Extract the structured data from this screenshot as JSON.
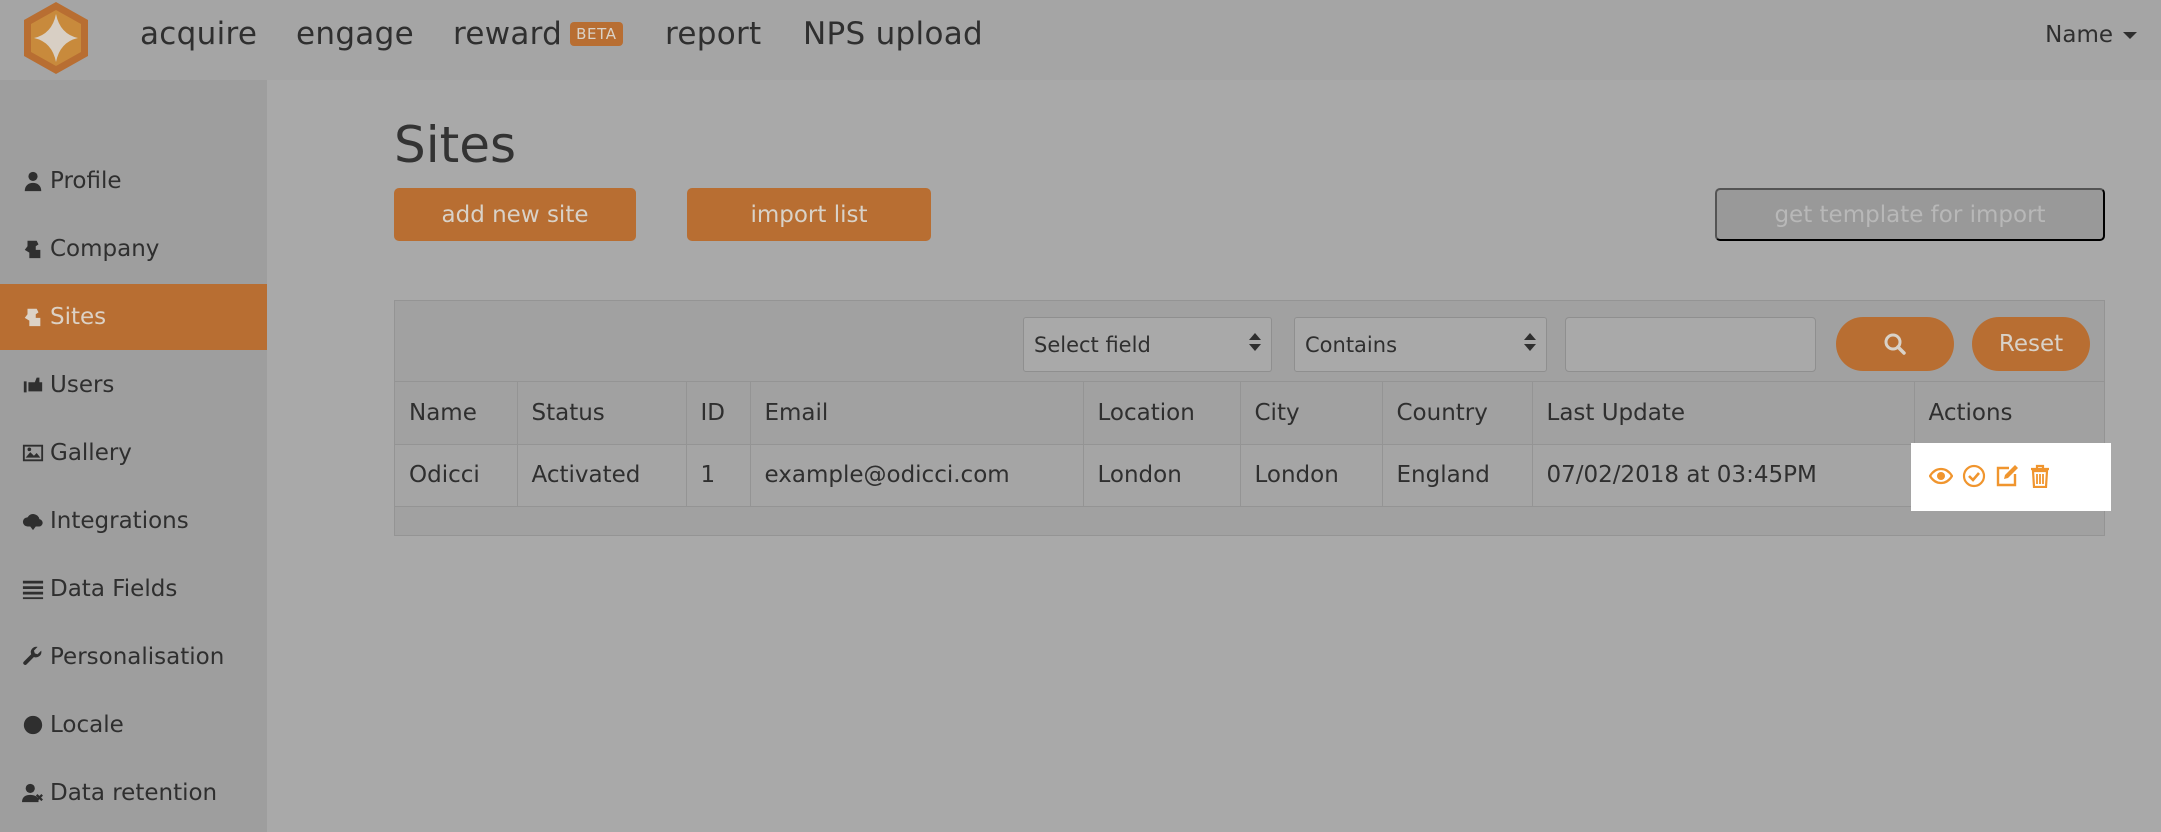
{
  "nav": {
    "items": [
      {
        "label": "acquire"
      },
      {
        "label": "engage"
      },
      {
        "label": "reward",
        "badge": "BETA"
      },
      {
        "label": "report"
      },
      {
        "label": "NPS upload"
      }
    ],
    "user": "Name"
  },
  "sidebar": {
    "items": [
      {
        "label": "Profile",
        "icon": "user-icon"
      },
      {
        "label": "Company",
        "icon": "company-icon"
      },
      {
        "label": "Sites",
        "icon": "sites-icon",
        "active": true
      },
      {
        "label": "Users",
        "icon": "users-hand-icon"
      },
      {
        "label": "Gallery",
        "icon": "image-icon"
      },
      {
        "label": "Integrations",
        "icon": "cloud-download-icon"
      },
      {
        "label": "Data Fields",
        "icon": "list-icon"
      },
      {
        "label": "Personalisation",
        "icon": "wrench-icon"
      },
      {
        "label": "Locale",
        "icon": "globe-icon"
      },
      {
        "label": "Data retention",
        "icon": "user-remove-icon"
      }
    ]
  },
  "page": {
    "title": "Sites",
    "add_button": "add new site",
    "import_button": "import list",
    "template_button": "get template for import"
  },
  "filter": {
    "field_select": "Select field",
    "operator_select": "Contains",
    "search_value": "",
    "reset_label": "Reset"
  },
  "table": {
    "headers": [
      "Name",
      "Status",
      "ID",
      "Email",
      "Location",
      "City",
      "Country",
      "Last Update",
      "Actions"
    ],
    "rows": [
      {
        "name": "Odicci",
        "status": "Activated",
        "id": "1",
        "email": "example@odicci.com",
        "location": "London",
        "city": "London",
        "country": "England",
        "last_update": "07/02/2018 at 03:45PM"
      }
    ]
  },
  "colors": {
    "accent": "#b86e32",
    "action_icon": "#f0952e",
    "background": "#a9a9a9"
  }
}
